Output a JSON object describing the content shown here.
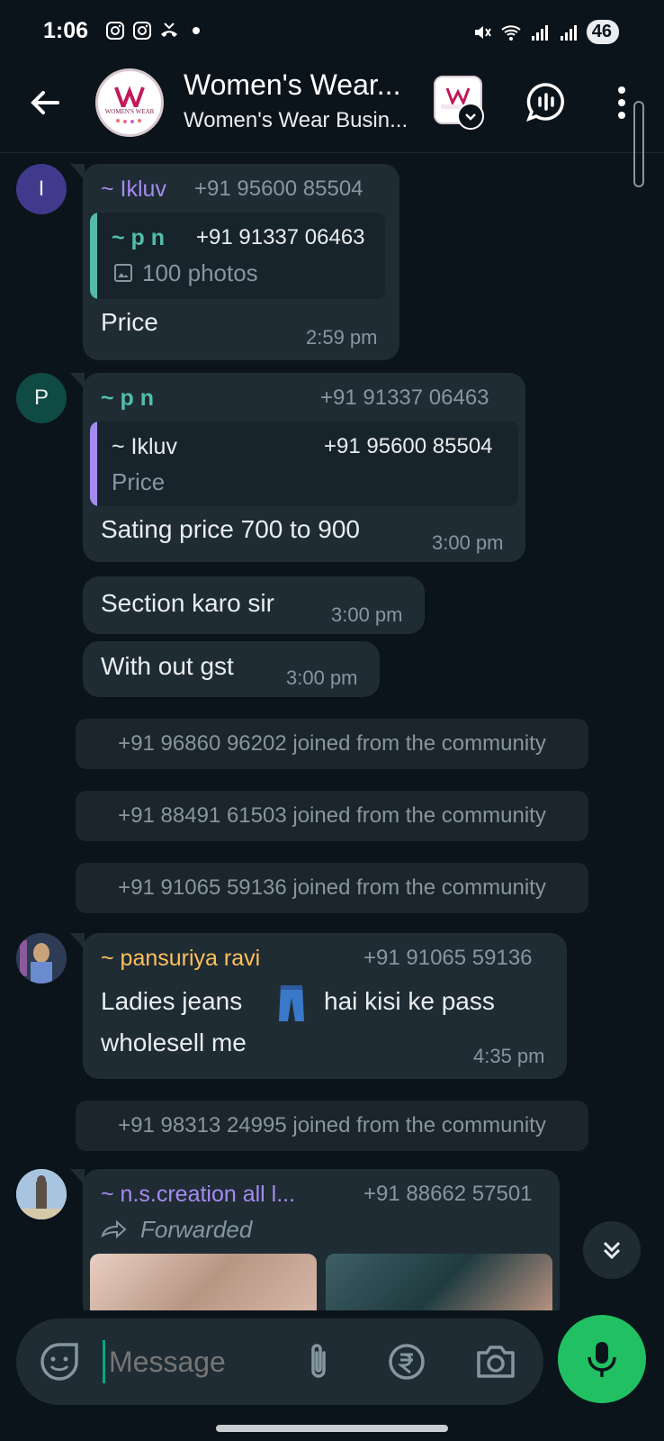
{
  "status_bar": {
    "time": "1:06",
    "battery": "46"
  },
  "header": {
    "title": "Women's Wear...",
    "subtitle": "Women's Wear Busin...",
    "logo_text": "WOMEN'S WEAR"
  },
  "messages": [
    {
      "sender": "~ Ikluv",
      "phone": "+91 95600 85504",
      "avatar_letter": "I",
      "quote_sender": "~ p n",
      "quote_phone": "+91 91337 06463",
      "quote_text": "100 photos",
      "text": "Price",
      "time": "2:59 pm"
    },
    {
      "sender": "~ p n",
      "phone": "+91 91337 06463",
      "avatar_letter": "P",
      "quote_sender": "~ Ikluv",
      "quote_phone": "+91 95600 85504",
      "quote_text": "Price",
      "text": "Sating price 700 to 900",
      "time": "3:00 pm"
    },
    {
      "text": "Section karo sir",
      "time": "3:00 pm"
    },
    {
      "text": "With out gst",
      "time": "3:00 pm"
    },
    {
      "sender": "~ pansuriya ravi",
      "phone": "+91 91065 59136",
      "text_line1_a": "Ladies jeans",
      "text_line1_b": "hai kisi ke pass",
      "text_line2": "wholesell me",
      "time": "4:35 pm"
    },
    {
      "sender": "~ n.s.creation all l...",
      "phone": "+91 88662 57501",
      "forwarded": "Forwarded"
    }
  ],
  "system_messages": [
    "+91 96860 96202 joined from the community",
    "+91 88491 61503 joined from the community",
    "+91 91065 59136 joined from the community",
    "+91 98313 24995 joined from the community"
  ],
  "input": {
    "placeholder": "Message"
  },
  "colors": {
    "ikluv": "#a58bf0",
    "pn": "#53bdac",
    "ravi": "#ffc05c",
    "nscreation": "#a58bf0",
    "accent": "#21c063"
  }
}
